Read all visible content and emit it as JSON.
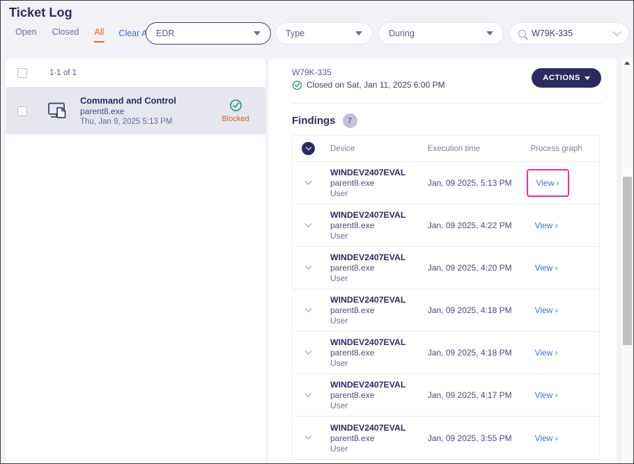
{
  "header": {
    "title": "Ticket Log",
    "tabs": [
      {
        "label": "Open",
        "active": false
      },
      {
        "label": "Closed",
        "active": false
      },
      {
        "label": "All",
        "active": true
      }
    ],
    "clear_all_label": "Clear All",
    "filters": [
      {
        "name": "edr",
        "value": "EDR",
        "focused": true
      },
      {
        "name": "type",
        "value": "Type",
        "focused": false
      },
      {
        "name": "during",
        "value": "During",
        "focused": false
      }
    ],
    "search": {
      "value": "W79K-335",
      "icon": "search-icon"
    }
  },
  "ticket_list": {
    "count_label": "1-1 of 1",
    "items": [
      {
        "title": "Command and Control",
        "process": "parent8.exe",
        "date": "Thu, Jan 9, 2025 5:13 PM",
        "status": "Blocked",
        "status_icon": "check-circle-icon",
        "icon": "endpoint-process-icon",
        "selected": true
      }
    ]
  },
  "detail": {
    "ticket_id": "W79K-335",
    "closed_text": "Closed on Sat, Jan 11, 2025 6:00 PM",
    "closed_icon": "check-circle-icon",
    "actions_label": "ACTIONS",
    "findings_title": "Findings",
    "findings_count": "7",
    "table": {
      "columns": [
        "Device",
        "Execution time",
        "Process graph"
      ],
      "rows": [
        {
          "device": "WINDEV2407EVAL",
          "process": "parent8.exe",
          "user": "User",
          "time": "Jan, 09 2025, 5:13 PM",
          "link": "View ›",
          "highlighted": true
        },
        {
          "device": "WINDEV2407EVAL",
          "process": "parent8.exe",
          "user": "User",
          "time": "Jan, 09 2025, 4:22 PM",
          "link": "View ›",
          "highlighted": false
        },
        {
          "device": "WINDEV2407EVAL",
          "process": "parent8.exe",
          "user": "User",
          "time": "Jan, 09 2025, 4:20 PM",
          "link": "View ›",
          "highlighted": false
        },
        {
          "device": "WINDEV2407EVAL",
          "process": "parent8.exe",
          "user": "User",
          "time": "Jan, 09 2025, 4:18 PM",
          "link": "View ›",
          "highlighted": false
        },
        {
          "device": "WINDEV2407EVAL",
          "process": "parent8.exe",
          "user": "User",
          "time": "Jan, 09 2025, 4:18 PM",
          "link": "View ›",
          "highlighted": false
        },
        {
          "device": "WINDEV2407EVAL",
          "process": "parent8.exe",
          "user": "User",
          "time": "Jan, 09 2025, 4:17 PM",
          "link": "View ›",
          "highlighted": false
        },
        {
          "device": "WINDEV2407EVAL",
          "process": "parent8.exe",
          "user": "User",
          "time": "Jan, 09 2025, 3:55 PM",
          "link": "View ›",
          "highlighted": false
        }
      ]
    }
  },
  "colors": {
    "accent_orange": "#e4611a",
    "link_blue": "#3d6fd4",
    "navy": "#2b2b62",
    "status_green": "#19a06a",
    "status_blocked": "#d4622e",
    "highlight_pink": "#ea2ba8"
  }
}
